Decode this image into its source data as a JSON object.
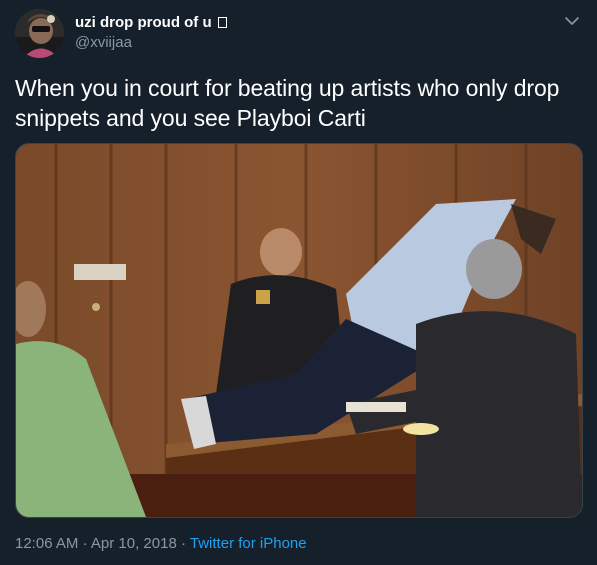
{
  "user": {
    "display_name": "uzi drop proud of u",
    "handle": "@xviijaa"
  },
  "tweet": {
    "text": "When you in court for beating up artists who only drop snippets and you see Playboi Carti"
  },
  "meta": {
    "time": "12:06 AM",
    "separator": "·",
    "date": "Apr 10, 2018",
    "source": "Twitter for iPhone"
  },
  "colors": {
    "background": "#15202b",
    "secondary_text": "#8899a6",
    "link": "#1da1f2"
  },
  "icons": {
    "menu": "chevron-down-icon"
  }
}
